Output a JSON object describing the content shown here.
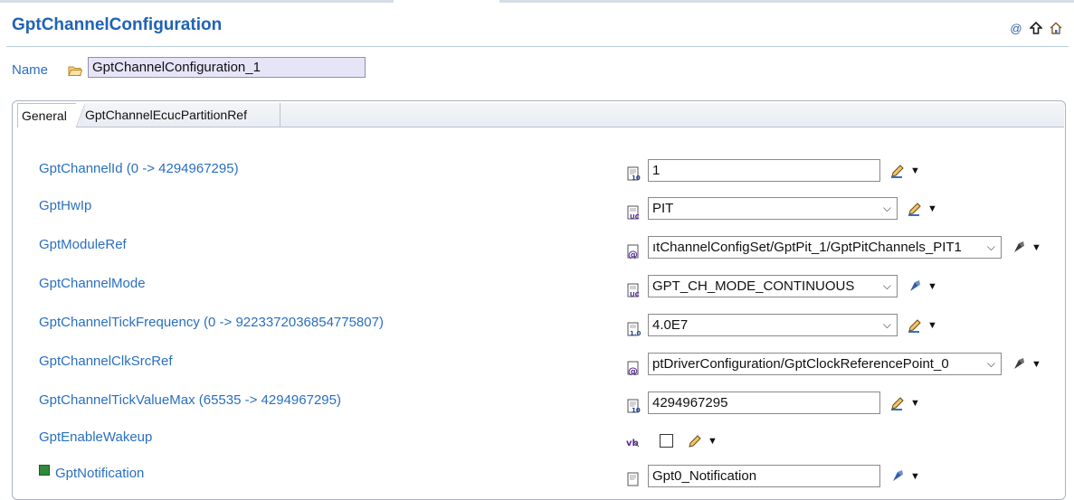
{
  "title": "GptChannelConfiguration",
  "name_label": "Name",
  "name_value": "GptChannelConfiguration_1",
  "header_icons": [
    "at-icon",
    "up-arrow-icon",
    "home-icon"
  ],
  "tabs": [
    {
      "label": "General",
      "active": true
    },
    {
      "label": "GptChannelEcucPartitionRef",
      "active": false
    }
  ],
  "params": [
    {
      "label": "GptChannelId (0 -> 4294967295)",
      "value": "1",
      "type": "integer"
    },
    {
      "label": "GptHwIp",
      "value": "PIT",
      "type": "enum"
    },
    {
      "label": "GptModuleRef",
      "value": "ıtChannelConfigSet/GptPit_1/GptPitChannels_PIT1",
      "type": "reference"
    },
    {
      "label": "GptChannelMode",
      "value": "GPT_CH_MODE_CONTINUOUS",
      "type": "enum"
    },
    {
      "label": "GptChannelTickFrequency (0 -> 9223372036854775807)",
      "value": "4.0E7",
      "type": "float"
    },
    {
      "label": "GptChannelClkSrcRef",
      "value": "ptDriverConfiguration/GptClockReferencePoint_0",
      "type": "reference"
    },
    {
      "label": "GptChannelTickValueMax (65535 -> 4294967295)",
      "value": "4294967295",
      "type": "integer"
    },
    {
      "label": "GptEnableWakeup",
      "value": "",
      "type": "boolean"
    },
    {
      "label": "GptNotification",
      "value": "Gpt0_Notification",
      "type": "function"
    }
  ],
  "colors": {
    "label": "#2a6fc0",
    "title": "#1f63b6",
    "name_field_bg": "#e6e4f7"
  }
}
